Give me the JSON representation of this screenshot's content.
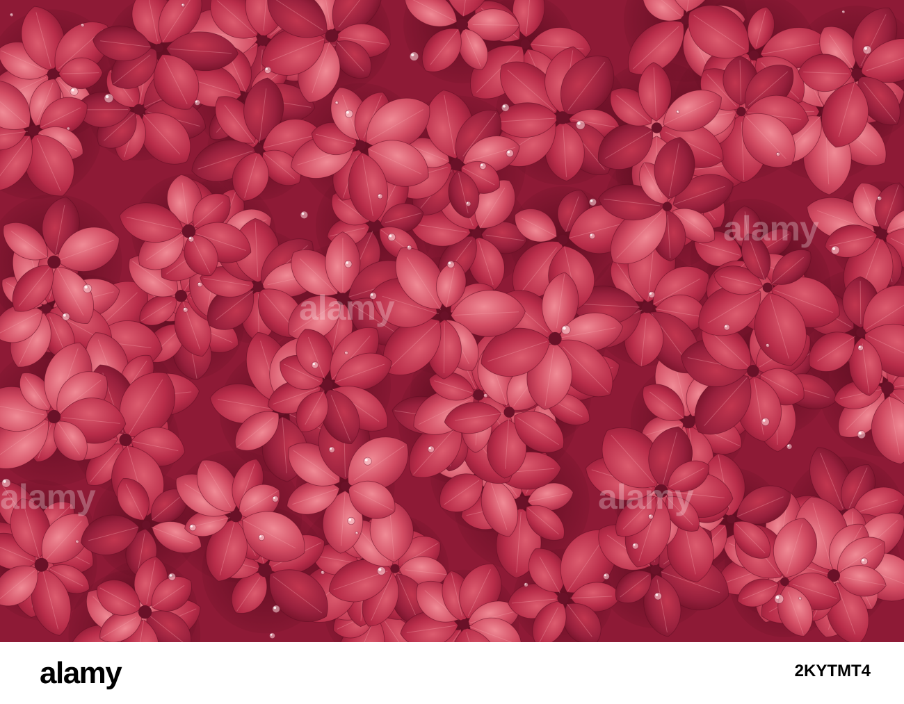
{
  "photo": {
    "subject": "leaf-foliage",
    "colors": {
      "base": "#9c1e3c",
      "deep": "#6e1026",
      "mid": "#c2364f",
      "light": "#dc5c6f",
      "highlight": "#f08b96"
    }
  },
  "watermark": {
    "text": "alamy"
  },
  "footer": {
    "brand_name": "alamy",
    "image_id": "2KYTMT4"
  }
}
